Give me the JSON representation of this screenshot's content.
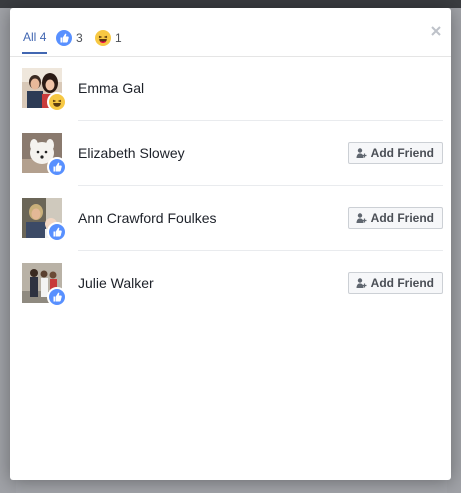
{
  "tabs": {
    "all_label": "All",
    "all_count": "4",
    "like_icon": "like-icon",
    "like_count": "3",
    "haha_icon": "haha-icon",
    "haha_count": "1"
  },
  "close_icon": "close-icon",
  "people": [
    {
      "name": "Emma Gal",
      "reaction": "haha",
      "action": ""
    },
    {
      "name": "Elizabeth Slowey",
      "reaction": "like",
      "action": "Add Friend"
    },
    {
      "name": "Ann Crawford Foulkes",
      "reaction": "like",
      "action": "Add Friend"
    },
    {
      "name": "Julie Walker",
      "reaction": "like",
      "action": "Add Friend"
    }
  ],
  "colors": {
    "accent": "#4267b2",
    "like": "#5890ff",
    "haha": "#f7c843"
  }
}
